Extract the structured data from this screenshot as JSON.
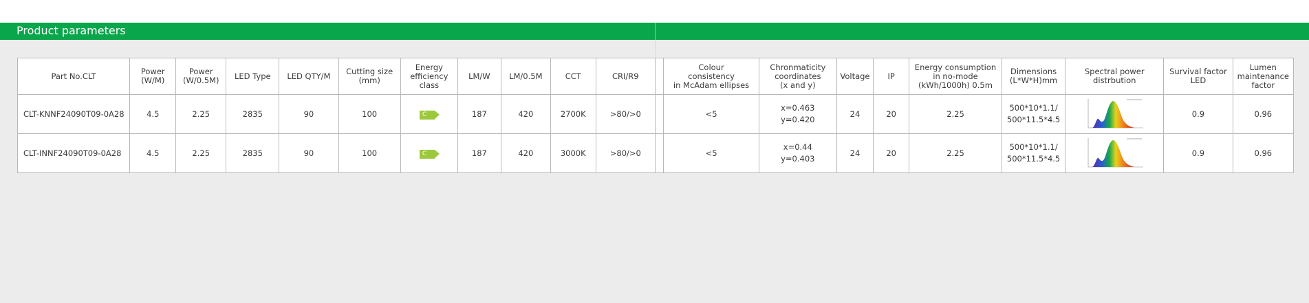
{
  "banner": {
    "title": "Product parameters"
  },
  "colors": {
    "banner_green": "#0aa64b",
    "badge_green": "#9cc83b",
    "background": "#ececec"
  },
  "table": {
    "headers": [
      "Part No.CLT",
      "Power\n(W/M)",
      "Power\n(W/0.5M)",
      "LED Type",
      "LED QTY/M",
      "Cutting size\n(mm)",
      "Energy\nefficiency\nclass",
      "LM/W",
      "LM/0.5M",
      "CCT",
      "CRI/R9",
      "",
      "Colour\nconsistency\nin McAdam ellipses",
      "Chronmaticity\ncoordinates\n(x and y)",
      "Voltage",
      "IP",
      "Energy consumption\nin no-mode\n(kWh/1000h) 0.5m",
      "Dimensions\n(L*W*H)mm",
      "Spectral power\ndistrbution",
      "Survival factor\nLED",
      "Lumen\nmaintenance\nfactor"
    ],
    "rows": [
      {
        "part_no": "CLT-KNNF24090T09-0A28",
        "power_wm": "4.5",
        "power_w05m": "2.25",
        "led_type": "2835",
        "led_qty": "90",
        "cutting_size": "100",
        "energy_class": "C",
        "lm_w": "187",
        "lm_05m": "420",
        "cct": "2700K",
        "cri_r9": ">80/>0",
        "colour_consistency": "<5",
        "chroma_x": "x=0.463",
        "chroma_y": "y=0.420",
        "voltage": "24",
        "ip": "20",
        "energy_consumption": "2.25",
        "dimensions_1": "500*10*1.1/",
        "dimensions_2": "500*11.5*4.5",
        "survival_factor": "0.9",
        "lumen_maintenance": "0.96"
      },
      {
        "part_no": "CLT-INNF24090T09-0A28",
        "power_wm": "4.5",
        "power_w05m": "2.25",
        "led_type": "2835",
        "led_qty": "90",
        "cutting_size": "100",
        "energy_class": "C",
        "lm_w": "187",
        "lm_05m": "420",
        "cct": "3000K",
        "cri_r9": ">80/>0",
        "colour_consistency": "<5",
        "chroma_x": "x=0.44",
        "chroma_y": "y=0.403",
        "voltage": "24",
        "ip": "20",
        "energy_consumption": "2.25",
        "dimensions_1": "500*10*1.1/",
        "dimensions_2": "500*11.5*4.5",
        "survival_factor": "0.9",
        "lumen_maintenance": "0.96"
      }
    ]
  }
}
